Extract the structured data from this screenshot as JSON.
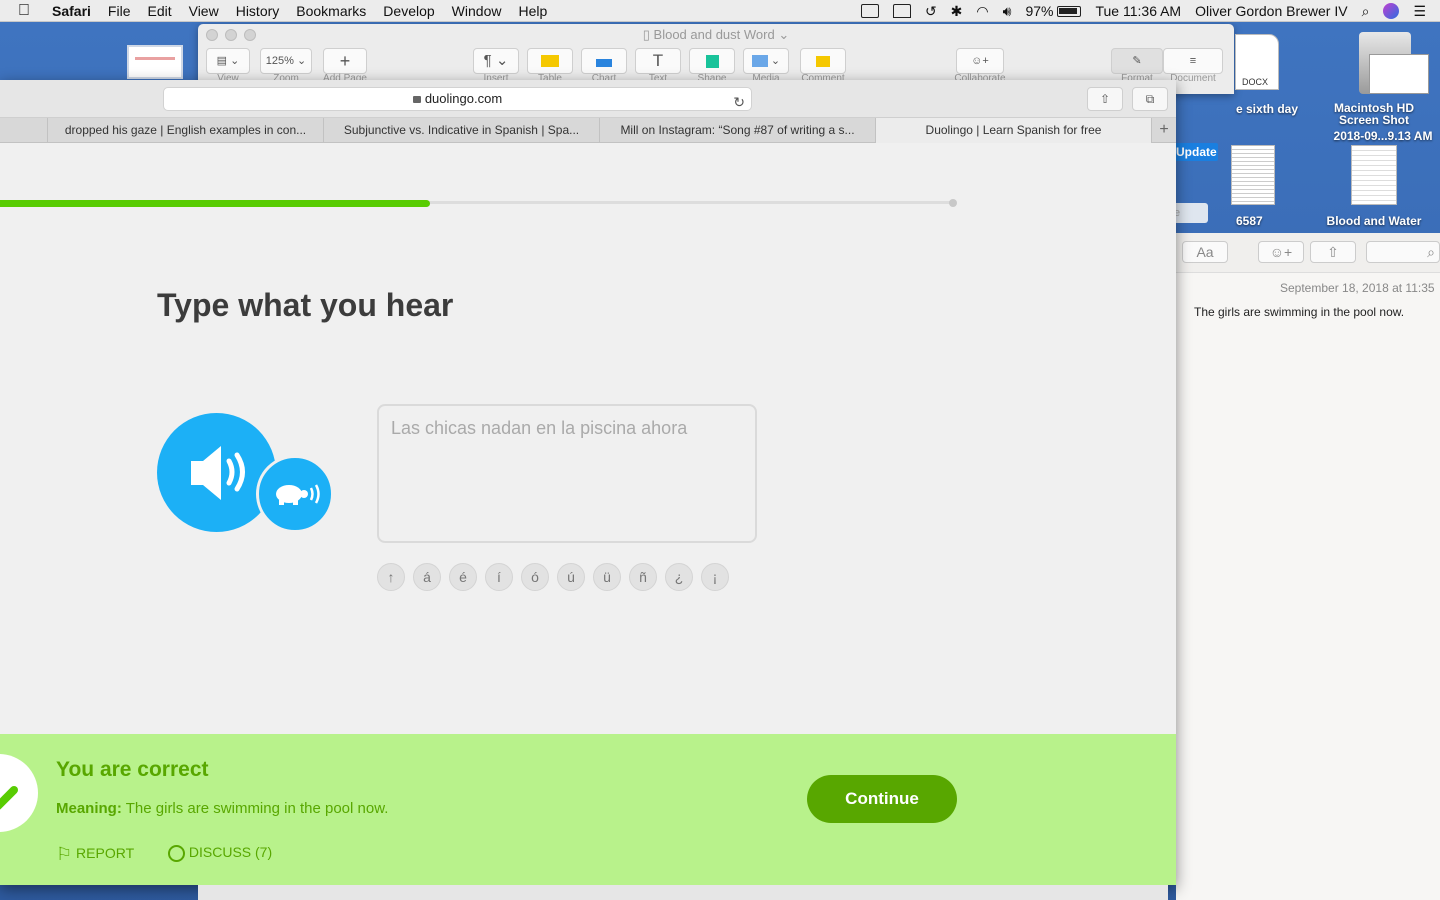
{
  "menubar": {
    "app": "Safari",
    "items": [
      "File",
      "Edit",
      "View",
      "History",
      "Bookmarks",
      "Develop",
      "Window",
      "Help"
    ],
    "battery": "97%",
    "clock": "Tue 11:36 AM",
    "user": "Oliver Gordon Brewer IV"
  },
  "pages": {
    "title": "Blood and dust Word",
    "zoom": "125%",
    "labels": [
      "View",
      "Zoom",
      "Add Page",
      "Insert",
      "Table",
      "Chart",
      "Text",
      "Shape",
      "Media",
      "Comment",
      "Collaborate",
      "Format",
      "Document"
    ]
  },
  "desktop": {
    "docx_tag": "DOCX",
    "sixth_day": "e sixth day",
    "mac_hd": "Macintosh HD",
    "screenshot_1": "Screen Shot",
    "screenshot_2": "2018-09...9.13 AM",
    "file_6587": "6587",
    "blood_water": "Blood and Water",
    "update": "Update"
  },
  "notes": {
    "date": "September 18, 2018 at 11:35",
    "body": "The girls are swimming in the pool now.",
    "font_btn": "Aa"
  },
  "safari": {
    "url": "duolingo.com",
    "tabs": [
      "dropped his gaze | English examples in con...",
      "Subjunctive vs. Indicative in Spanish | Spa...",
      "Mill on Instagram: “Song #87 of writing a s...",
      "Duolingo | Learn Spanish for free"
    ]
  },
  "lesson": {
    "progress": 0.45,
    "prompt": "Type what you hear",
    "answer": "Las chicas nadan en la piscina ahora",
    "keys": [
      "↑",
      "á",
      "é",
      "í",
      "ó",
      "ú",
      "ü",
      "ñ",
      "¿",
      "¡"
    ]
  },
  "result": {
    "title": "You are correct",
    "meaning_label": "Meaning:",
    "meaning_text": "The girls are swimming in the pool now.",
    "report": "REPORT",
    "discuss": "DISCUSS (7)",
    "continue": "Continue"
  },
  "colors": {
    "duo_blue": "#1cb0f6",
    "duo_green": "#58cc02",
    "banner_green": "#b8f28b",
    "button_green": "#58a700"
  }
}
